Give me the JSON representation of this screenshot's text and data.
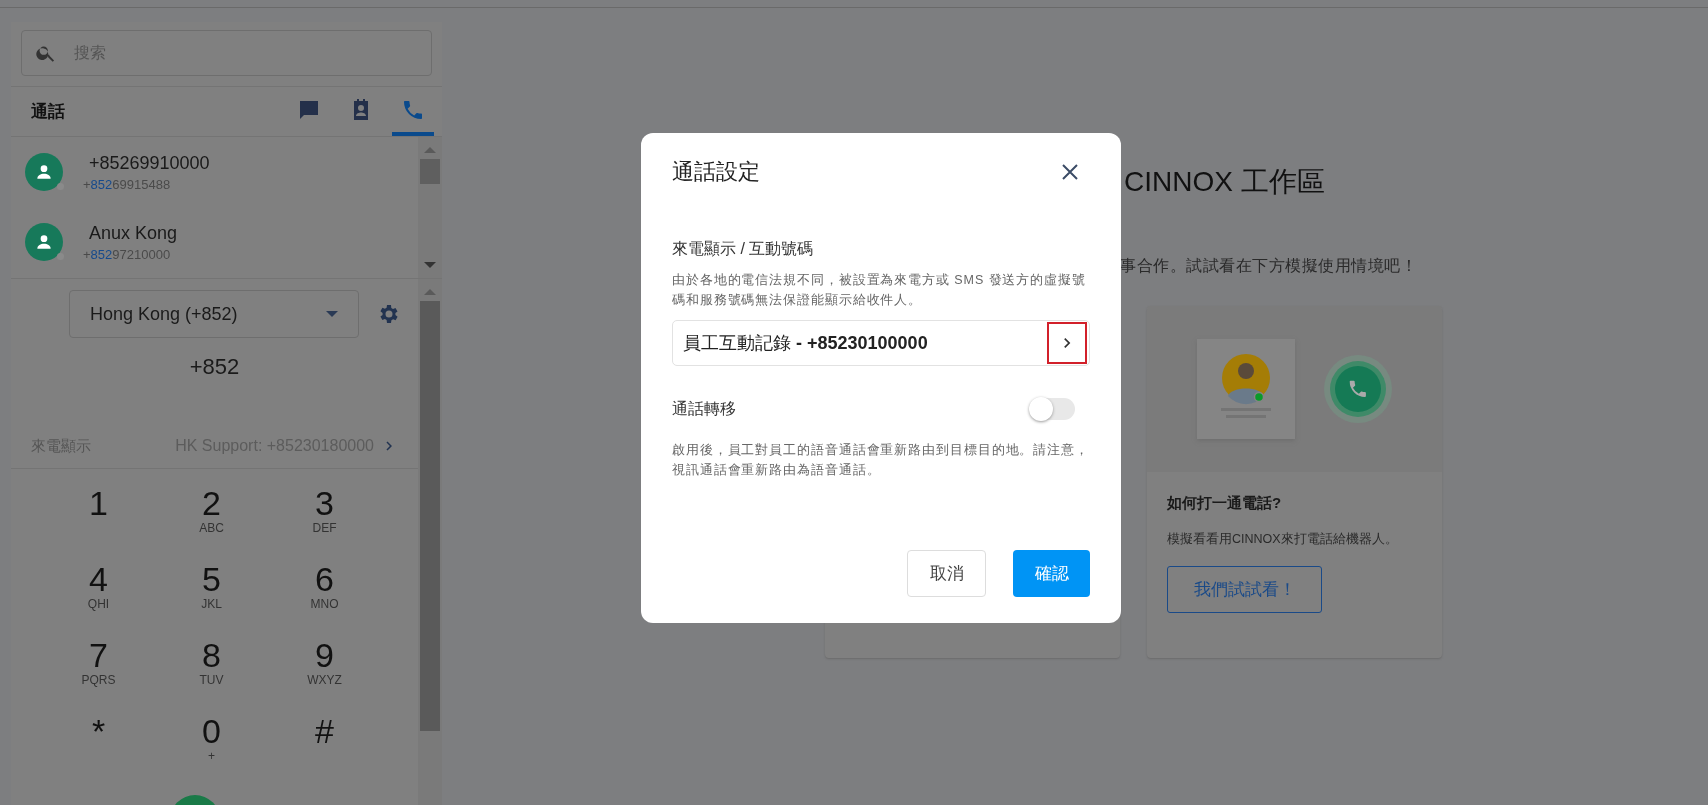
{
  "search": {
    "placeholder": "搜索"
  },
  "panel": {
    "title": "通話",
    "tabs": [
      {
        "kind": "chat",
        "selected": false
      },
      {
        "kind": "contacts",
        "selected": false
      },
      {
        "kind": "phone",
        "selected": true
      }
    ]
  },
  "contacts": [
    {
      "name": "+85269910000",
      "number_parts": [
        {
          "text": "+",
          "highlight": false
        },
        {
          "text": "852",
          "highlight": true
        },
        {
          "text": "69915488",
          "highlight": false
        }
      ]
    },
    {
      "name": "Anux Kong",
      "number_parts": [
        {
          "text": "+",
          "highlight": false
        },
        {
          "text": "852",
          "highlight": true
        },
        {
          "text": "97210000",
          "highlight": false
        }
      ]
    }
  ],
  "dialer": {
    "country": "Hong Kong (+852)",
    "number": "+852",
    "caller_id_label": "來電顯示",
    "caller_id_value": "HK Support: +85230180000",
    "keys": [
      {
        "digit": "1"
      },
      {
        "digit": "2",
        "letters": "ABC"
      },
      {
        "digit": "3",
        "letters": "DEF"
      },
      {
        "digit": "4",
        "letters": "QHI"
      },
      {
        "digit": "5",
        "letters": "JKL"
      },
      {
        "digit": "6",
        "letters": "MNO"
      },
      {
        "digit": "7",
        "letters": "PQRS"
      },
      {
        "digit": "8",
        "letters": "TUV"
      },
      {
        "digit": "9",
        "letters": "WXYZ"
      },
      {
        "digit": "*"
      },
      {
        "digit": "0",
        "letters": "+"
      },
      {
        "digit": "#"
      }
    ]
  },
  "main": {
    "title": "CINNOX 工作區",
    "subtitle": "事合作。試試看在下方模擬使用情境吧！",
    "card": {
      "title": "如何打一通電話?",
      "description": "模擬看看用CINNOX來打電話給機器人。",
      "button": "我們試試看！"
    }
  },
  "dialog": {
    "title": "通話設定",
    "caller_id_section": "來電顯示 / 互動號碼",
    "caller_id_note": "由於各地的電信法規不同，被設置為來電方或 SMS 發送方的虛擬號碼和服務號碼無法保證能顯示給收件人。",
    "selected_number": "員工互動記錄 **- +85230100000**",
    "chevron_highlighted": true,
    "forwarding": {
      "label": "通話轉移",
      "on": false,
      "note": "啟用後，員工對員工的語音通話會重新路由到目標目的地。請注意，視訊通話會重新路由為語音通話。"
    },
    "buttons": [
      {
        "label": "取消",
        "kind": "secondary"
      },
      {
        "label": "確認",
        "kind": "primary"
      }
    ]
  }
}
